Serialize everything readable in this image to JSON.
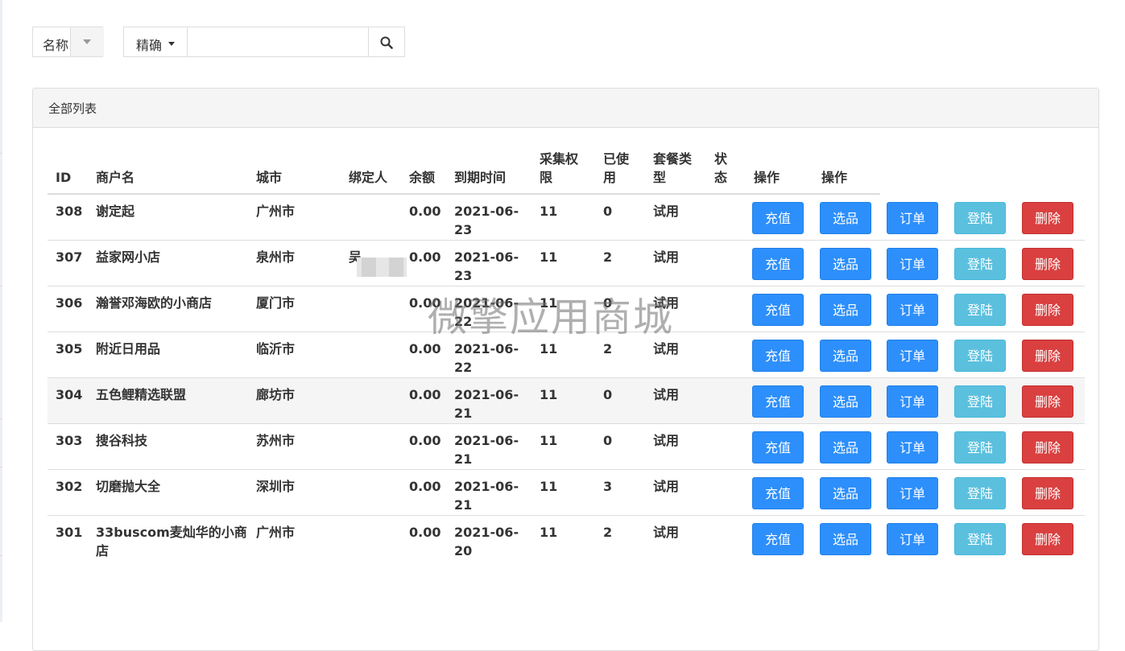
{
  "filter": {
    "field_label": "名称",
    "mode_label": "精确",
    "search_value": ""
  },
  "panel": {
    "title": "全部列表"
  },
  "columns": [
    "ID",
    "商户名",
    "城市",
    "绑定人",
    "余额",
    "到期时间",
    "采集权限",
    "已使用",
    "套餐类型",
    "状态",
    "操作",
    "操作"
  ],
  "column_lines": {
    "perm": [
      "采集权",
      "限"
    ],
    "used": [
      "已使",
      "用"
    ],
    "plan": [
      "套餐类",
      "型"
    ],
    "status": [
      "状",
      "态"
    ]
  },
  "actions": {
    "recharge": "充值",
    "select": "选品",
    "orders": "订单",
    "login": "登陆",
    "delete": "删除"
  },
  "rows": [
    {
      "id": "308",
      "name": "谢定起",
      "city": "广州市",
      "binder": "",
      "balance": "0.00",
      "expire_a": "2021-06-",
      "expire_b": "23",
      "perm": "11",
      "used": "0",
      "plan": "试用",
      "status": ""
    },
    {
      "id": "307",
      "name": "益家网小店",
      "city": "泉州市",
      "binder": "吴",
      "balance": "0.00",
      "expire_a": "2021-06-",
      "expire_b": "23",
      "perm": "11",
      "used": "2",
      "plan": "试用",
      "status": ""
    },
    {
      "id": "306",
      "name": "瀚誉邓海欧的小商店",
      "city": "厦门市",
      "binder": "",
      "balance": "0.00",
      "expire_a": "2021-06-",
      "expire_b": "22",
      "perm": "11",
      "used": "0",
      "plan": "试用",
      "status": ""
    },
    {
      "id": "305",
      "name": "附近日用品",
      "city": "临沂市",
      "binder": "",
      "balance": "0.00",
      "expire_a": "2021-06-",
      "expire_b": "22",
      "perm": "11",
      "used": "2",
      "plan": "试用",
      "status": ""
    },
    {
      "id": "304",
      "name": "五色鲤精选联盟",
      "city": "廊坊市",
      "binder": "",
      "balance": "0.00",
      "expire_a": "2021-06-",
      "expire_b": "21",
      "perm": "11",
      "used": "0",
      "plan": "试用",
      "status": ""
    },
    {
      "id": "303",
      "name": "搜谷科技",
      "city": "苏州市",
      "binder": "",
      "balance": "0.00",
      "expire_a": "2021-06-",
      "expire_b": "21",
      "perm": "11",
      "used": "0",
      "plan": "试用",
      "status": ""
    },
    {
      "id": "302",
      "name": "切磨抛大全",
      "city": "深圳市",
      "binder": "",
      "balance": "0.00",
      "expire_a": "2021-06-",
      "expire_b": "21",
      "perm": "11",
      "used": "3",
      "plan": "试用",
      "status": ""
    },
    {
      "id": "301",
      "name": "33buscom麦灿华的小商店",
      "city": "广州市",
      "binder": "",
      "balance": "0.00",
      "expire_a": "2021-06-",
      "expire_b": "20",
      "perm": "11",
      "used": "2",
      "plan": "试用",
      "status": ""
    }
  ],
  "watermark": "微擎应用商城",
  "colors": {
    "primary": "#2d8ffb",
    "info": "#5bc0de",
    "danger": "#d9403f"
  }
}
